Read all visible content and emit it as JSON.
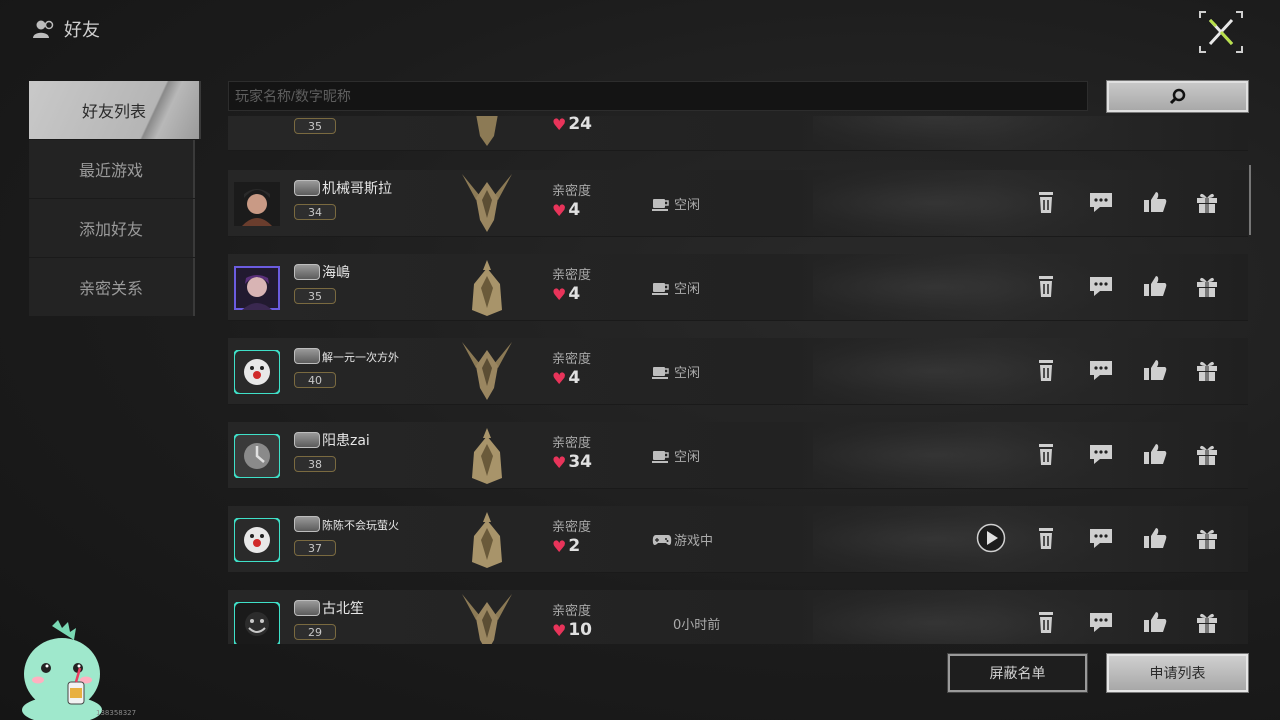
{
  "header": {
    "title": "好友"
  },
  "nav": [
    {
      "label": "好友列表",
      "active": true
    },
    {
      "label": "最近游戏",
      "active": false
    },
    {
      "label": "添加好友",
      "active": false
    },
    {
      "label": "亲密关系",
      "active": false
    }
  ],
  "search": {
    "placeholder": "玩家名称/数字昵称"
  },
  "friends_partial": {
    "level": "35",
    "intimacy": "24"
  },
  "intimacy_label": "亲密度",
  "friends": [
    {
      "name": "机械哥斯拉",
      "level": "34",
      "intimacy": "4",
      "status": "空闲",
      "status_icon": "cup-icon"
    },
    {
      "name": "海嶋",
      "level": "35",
      "intimacy": "4",
      "status": "空闲",
      "status_icon": "cup-icon"
    },
    {
      "name": "解一元一次方外",
      "level": "40",
      "intimacy": "4",
      "status": "空闲",
      "status_icon": "cup-icon"
    },
    {
      "name": "阳患zai",
      "level": "38",
      "intimacy": "34",
      "status": "空闲",
      "status_icon": "cup-icon"
    },
    {
      "name": "陈陈不会玩萤火",
      "level": "37",
      "intimacy": "2",
      "status": "游戏中",
      "status_icon": "gamepad-icon"
    },
    {
      "name": "古北笙",
      "level": "29",
      "intimacy": "10",
      "status": "0小时前",
      "status_icon": ""
    }
  ],
  "buttons": {
    "block_list": "屏蔽名单",
    "apply_list": "申请列表"
  },
  "mascot": {
    "id_text": "138358327"
  },
  "colors": {
    "heart": "#e8345a",
    "close_x": "#b8e04a"
  }
}
